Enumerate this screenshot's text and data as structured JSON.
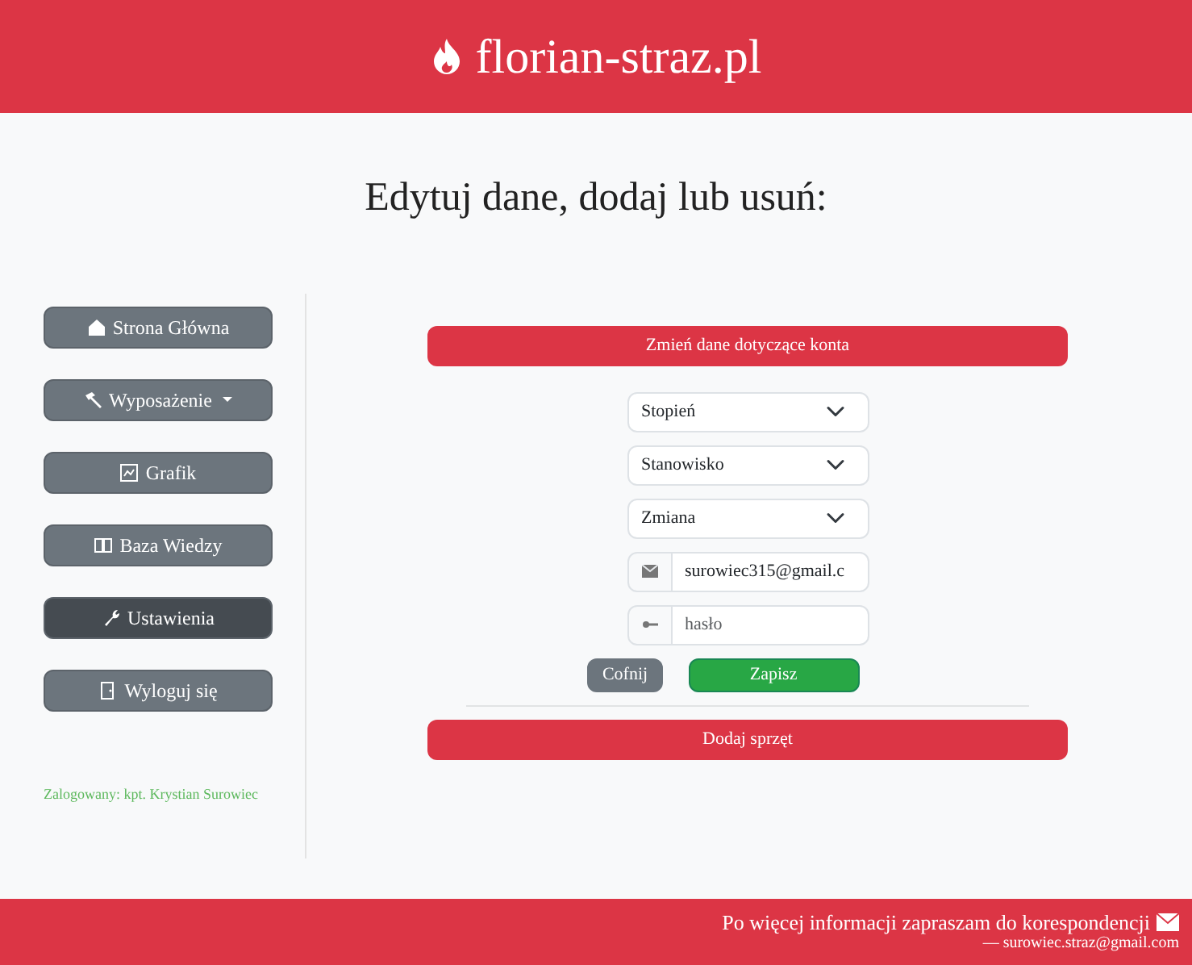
{
  "header": {
    "brand": "florian-straz.pl"
  },
  "page_title": "Edytuj dane, dodaj lub usuń:",
  "sidebar": {
    "items": [
      {
        "label": "Strona Główna",
        "selected": false,
        "dropdown": false
      },
      {
        "label": "Wyposażenie",
        "selected": false,
        "dropdown": true
      },
      {
        "label": "Grafik",
        "selected": false,
        "dropdown": false
      },
      {
        "label": "Baza Wiedzy",
        "selected": false,
        "dropdown": false
      },
      {
        "label": "Ustawienia",
        "selected": true,
        "dropdown": false
      },
      {
        "label": "Wyloguj się",
        "selected": false,
        "dropdown": false
      }
    ],
    "logged_in": "Zalogowany: kpt. Krystian Surowiec"
  },
  "form": {
    "section_button": "Zmień dane dotyczące konta",
    "selects": [
      {
        "placeholder": "Stopień"
      },
      {
        "placeholder": "Stanowisko"
      },
      {
        "placeholder": "Zmiana"
      }
    ],
    "email": {
      "value": "surowiec315@gmail.c"
    },
    "password": {
      "placeholder": "hasło"
    },
    "back_button": "Cofnij",
    "save_button": "Zapisz",
    "add_button": "Dodaj sprzęt"
  },
  "footer": {
    "text": "Po więcej informacji zapraszam do korespondencji",
    "email": "— surowiec.straz@gmail.com"
  }
}
